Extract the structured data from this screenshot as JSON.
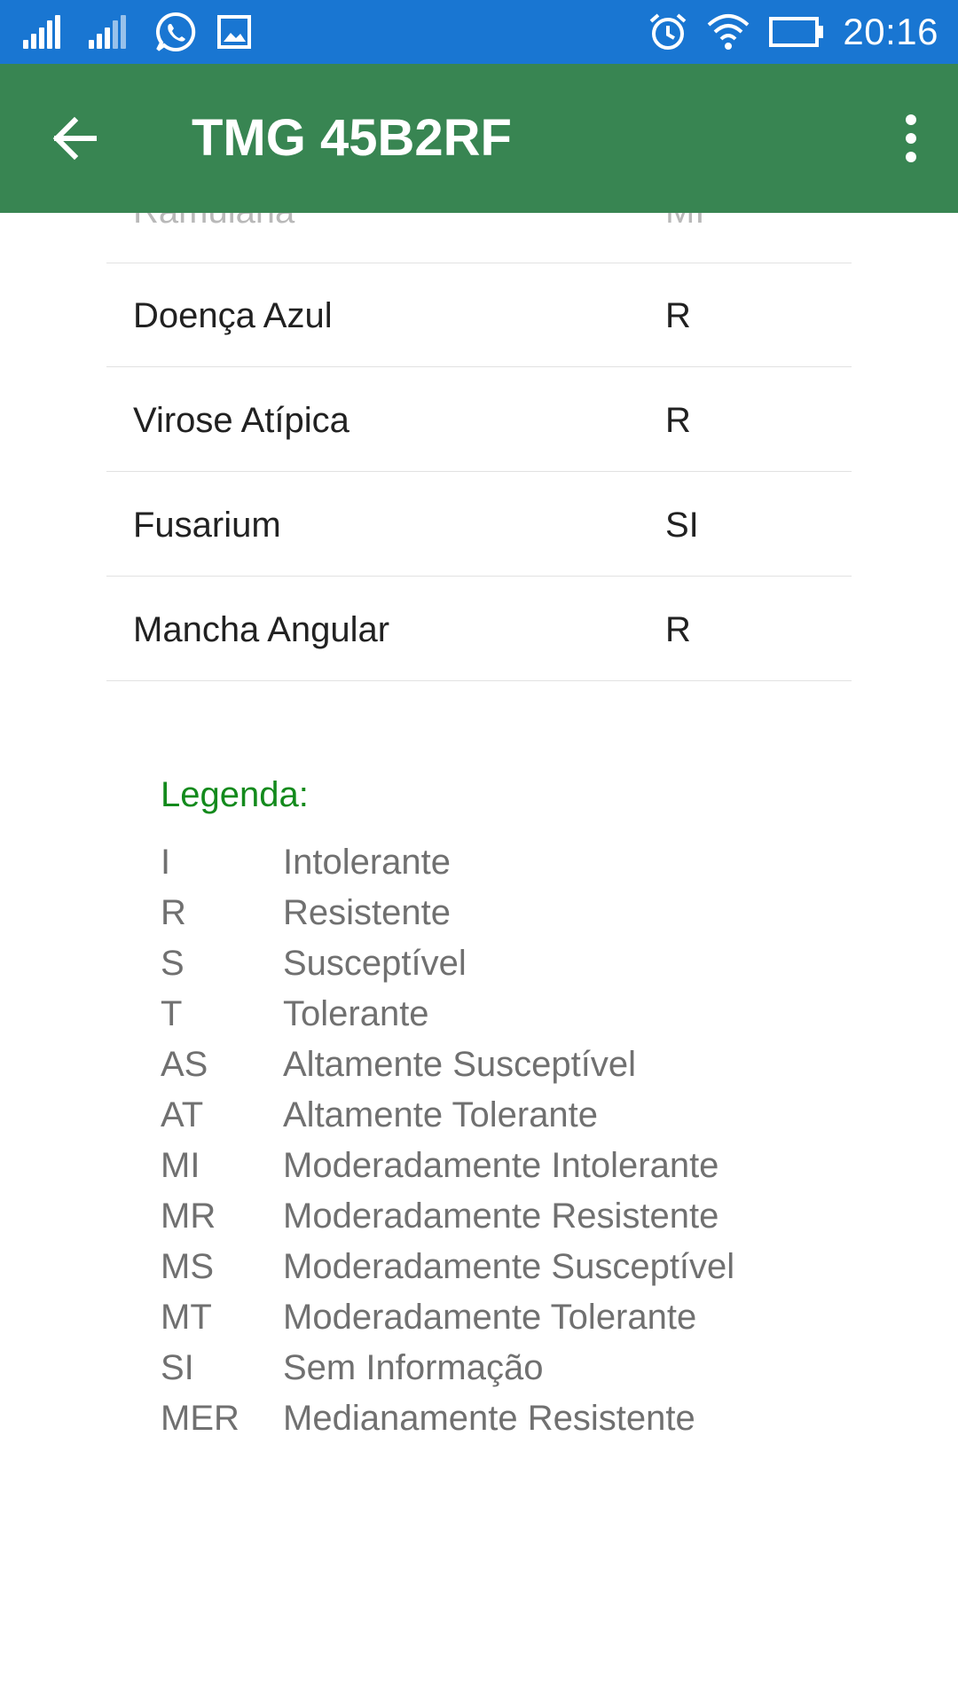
{
  "status_bar": {
    "time": "20:16",
    "icons": [
      "signal-icon",
      "signal-icon",
      "whatsapp-icon",
      "gallery-icon",
      "alarm-icon",
      "wifi-icon",
      "battery-icon"
    ]
  },
  "app_bar": {
    "title": "TMG 45B2RF",
    "back_icon": "arrow-left-icon",
    "menu_icon": "more-vert-icon"
  },
  "table": {
    "partial_row": {
      "name": "Ramulária",
      "value": "MI"
    },
    "rows": [
      {
        "name": "Doença Azul",
        "value": "R"
      },
      {
        "name": "Virose Atípica",
        "value": "R"
      },
      {
        "name": "Fusarium",
        "value": "SI"
      },
      {
        "name": "Mancha Angular",
        "value": "R"
      }
    ]
  },
  "legend": {
    "title": "Legenda:",
    "items": [
      {
        "code": "I",
        "label": "Intolerante"
      },
      {
        "code": "R",
        "label": "Resistente"
      },
      {
        "code": "S",
        "label": "Susceptível"
      },
      {
        "code": "T",
        "label": "Tolerante"
      },
      {
        "code": "AS",
        "label": "Altamente Susceptível"
      },
      {
        "code": "AT",
        "label": "Altamente Tolerante"
      },
      {
        "code": "MI",
        "label": "Moderadamente Intolerante"
      },
      {
        "code": "MR",
        "label": "Moderadamente Resistente"
      },
      {
        "code": "MS",
        "label": "Moderadamente Susceptível"
      },
      {
        "code": "MT",
        "label": "Moderadamente Tolerante"
      },
      {
        "code": "SI",
        "label": "Sem Informação"
      },
      {
        "code": "MER",
        "label": "Medianamente Resistente"
      }
    ]
  },
  "colors": {
    "status_bar": "#1976D2",
    "app_bar": "#388552",
    "legend_title": "#138a1c",
    "legend_text": "#707070",
    "row_text": "#212121"
  }
}
